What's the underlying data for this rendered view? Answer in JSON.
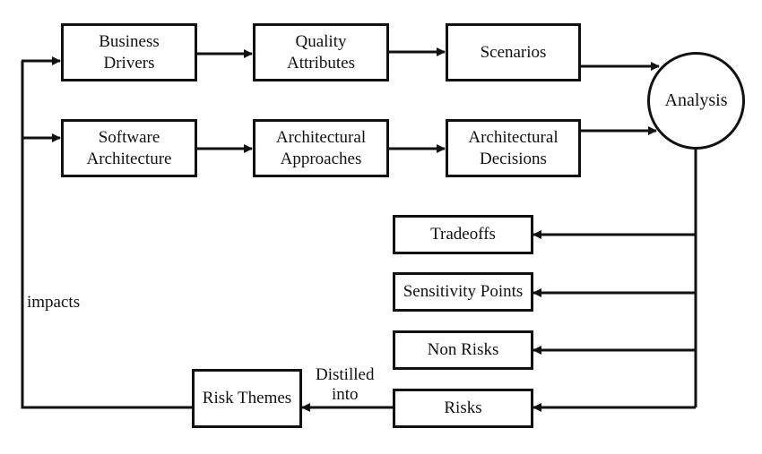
{
  "nodes": {
    "business_drivers": "Business\nDrivers",
    "quality_attributes": "Quality\nAttributes",
    "scenarios": "Scenarios",
    "software_architecture": "Software\nArchitecture",
    "architectural_approaches": "Architectural\nApproaches",
    "architectural_decisions": "Architectural\nDecisions",
    "analysis": "Analysis",
    "tradeoffs": "Tradeoffs",
    "sensitivity_points": "Sensitivity Points",
    "non_risks": "Non Risks",
    "risks": "Risks",
    "risk_themes": "Risk Themes"
  },
  "edge_labels": {
    "impacts": "impacts",
    "distilled_into": "Distilled\ninto"
  },
  "edges": [
    [
      "business_drivers",
      "quality_attributes"
    ],
    [
      "quality_attributes",
      "scenarios"
    ],
    [
      "scenarios",
      "analysis"
    ],
    [
      "software_architecture",
      "architectural_approaches"
    ],
    [
      "architectural_approaches",
      "architectural_decisions"
    ],
    [
      "architectural_decisions",
      "analysis"
    ],
    [
      "analysis",
      "tradeoffs"
    ],
    [
      "analysis",
      "sensitivity_points"
    ],
    [
      "analysis",
      "non_risks"
    ],
    [
      "analysis",
      "risks"
    ],
    [
      "risks",
      "risk_themes"
    ],
    [
      "risk_themes",
      "business_drivers"
    ],
    [
      "risk_themes",
      "software_architecture"
    ]
  ]
}
